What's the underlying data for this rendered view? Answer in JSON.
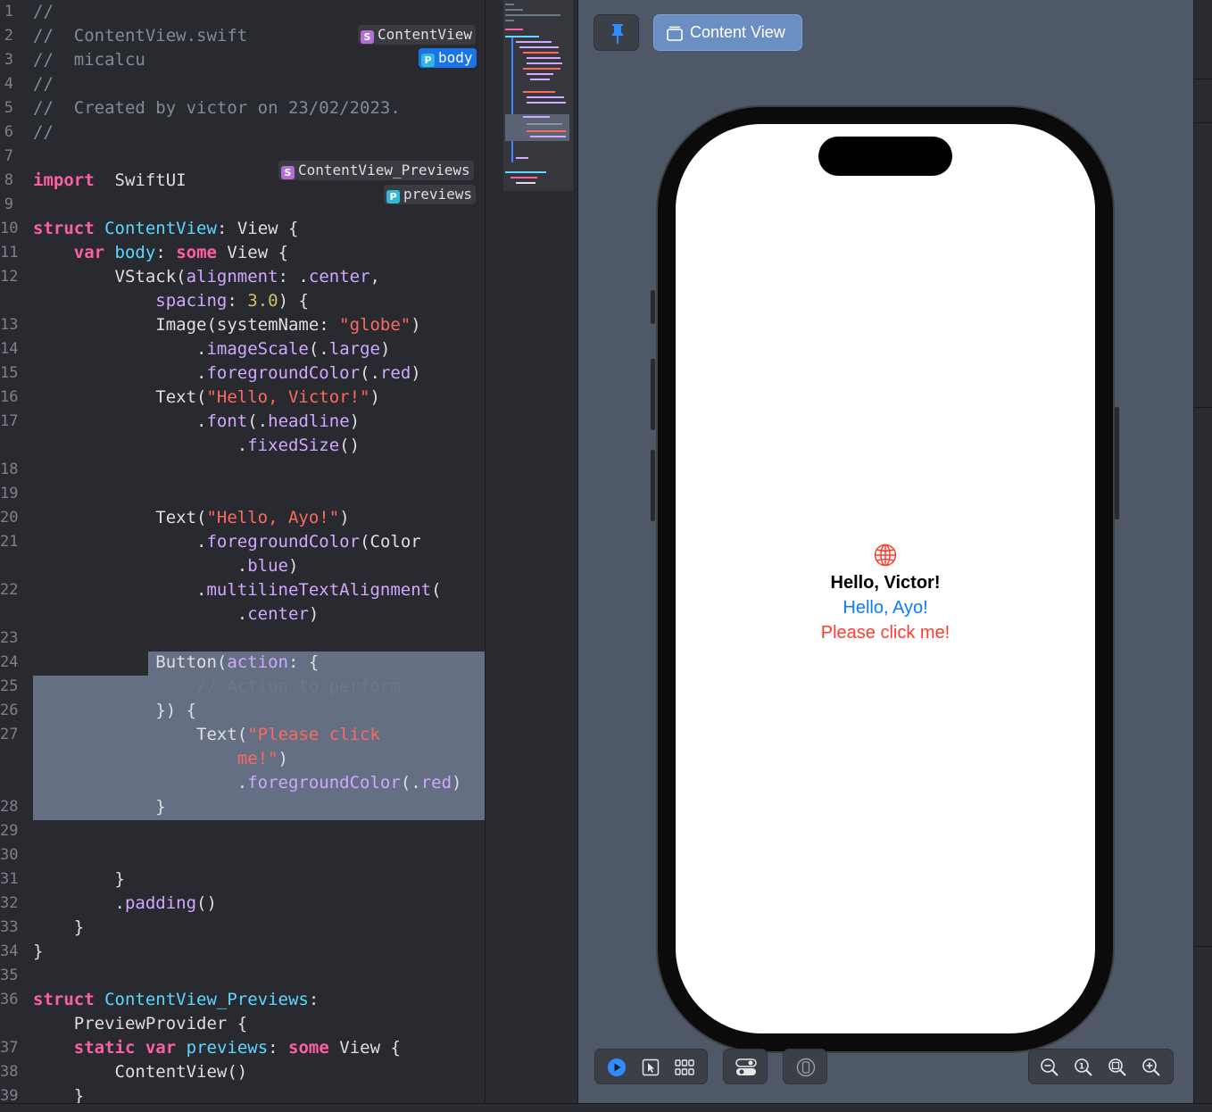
{
  "editor": {
    "lines": [
      {
        "n": "1",
        "t": [
          [
            "cm",
            "//"
          ]
        ]
      },
      {
        "n": "2",
        "t": [
          [
            "cm",
            "//  ContentView.swift"
          ]
        ]
      },
      {
        "n": "3",
        "t": [
          [
            "cm",
            "//  micalcu"
          ]
        ]
      },
      {
        "n": "4",
        "t": [
          [
            "cm",
            "//"
          ]
        ]
      },
      {
        "n": "5",
        "t": [
          [
            "cm",
            "//  Created by victor on 23/02/2023."
          ]
        ]
      },
      {
        "n": "6",
        "t": [
          [
            "cm",
            "//"
          ]
        ]
      },
      {
        "n": "7",
        "t": []
      },
      {
        "n": "8",
        "t": [
          [
            "kw",
            "import"
          ],
          [
            "",
            "  SwiftUI"
          ]
        ]
      },
      {
        "n": "9",
        "t": []
      },
      {
        "n": "10",
        "t": [
          [
            "kw",
            "struct"
          ],
          [
            "",
            " "
          ],
          [
            "ty",
            "ContentView"
          ],
          [
            "",
            ": View {"
          ]
        ]
      },
      {
        "n": "11",
        "t": [
          [
            "",
            "    "
          ],
          [
            "kw",
            "var"
          ],
          [
            "",
            " "
          ],
          [
            "ty",
            "body"
          ],
          [
            "",
            ": "
          ],
          [
            "kw",
            "some"
          ],
          [
            "",
            " View {"
          ]
        ]
      },
      {
        "n": "12",
        "t": [
          [
            "",
            "        VStack("
          ],
          [
            "pr",
            "alignment"
          ],
          [
            "",
            ": ."
          ],
          [
            "pr",
            "center"
          ],
          [
            "",
            ","
          ]
        ]
      },
      {
        "n": "",
        "t": [
          [
            "",
            "            "
          ],
          [
            "pr",
            "spacing"
          ],
          [
            "",
            ": "
          ],
          [
            "nm",
            "3.0"
          ],
          [
            "",
            ") {"
          ]
        ]
      },
      {
        "n": "13",
        "t": [
          [
            "",
            "            Image(systemName: "
          ],
          [
            "st",
            "\"globe\""
          ],
          [
            "",
            ")"
          ]
        ]
      },
      {
        "n": "14",
        "t": [
          [
            "",
            "                ."
          ],
          [
            "pr",
            "imageScale"
          ],
          [
            "",
            "(."
          ],
          [
            "pr",
            "large"
          ],
          [
            "",
            ")"
          ]
        ]
      },
      {
        "n": "15",
        "t": [
          [
            "",
            "                ."
          ],
          [
            "pr",
            "foregroundColor"
          ],
          [
            "",
            "(."
          ],
          [
            "pr",
            "red"
          ],
          [
            "",
            ")"
          ]
        ]
      },
      {
        "n": "16",
        "t": [
          [
            "",
            "            Text("
          ],
          [
            "st",
            "\"Hello, Victor!\""
          ],
          [
            "",
            ")"
          ]
        ]
      },
      {
        "n": "17",
        "t": [
          [
            "",
            "                ."
          ],
          [
            "pr",
            "font"
          ],
          [
            "",
            "(."
          ],
          [
            "pr",
            "headline"
          ],
          [
            "",
            ")"
          ]
        ]
      },
      {
        "n": "",
        "t": [
          [
            "",
            "                    ."
          ],
          [
            "pr",
            "fixedSize"
          ],
          [
            "",
            "()"
          ]
        ]
      },
      {
        "n": "18",
        "t": []
      },
      {
        "n": "19",
        "t": []
      },
      {
        "n": "20",
        "t": [
          [
            "",
            "            Text("
          ],
          [
            "st",
            "\"Hello, Ayo!\""
          ],
          [
            "",
            ")"
          ]
        ]
      },
      {
        "n": "21",
        "t": [
          [
            "",
            "                ."
          ],
          [
            "pr",
            "foregroundColor"
          ],
          [
            "",
            "(Color"
          ]
        ]
      },
      {
        "n": "",
        "t": [
          [
            "",
            "                    ."
          ],
          [
            "pr",
            "blue"
          ],
          [
            "",
            ")"
          ]
        ]
      },
      {
        "n": "22",
        "t": [
          [
            "",
            "                ."
          ],
          [
            "pr",
            "multilineTextAlignment"
          ],
          [
            "",
            "("
          ]
        ]
      },
      {
        "n": "",
        "t": [
          [
            "",
            "                    ."
          ],
          [
            "pr",
            "center"
          ],
          [
            "",
            ")"
          ]
        ]
      },
      {
        "n": "23",
        "t": []
      },
      {
        "n": "24",
        "t": [
          [
            "",
            "            Button("
          ],
          [
            "pr",
            "action"
          ],
          [
            "",
            ": {"
          ]
        ]
      },
      {
        "n": "25",
        "t": [
          [
            "",
            "                "
          ],
          [
            "cmd",
            "// Action to perform"
          ]
        ]
      },
      {
        "n": "26",
        "t": [
          [
            "",
            "            }) {"
          ]
        ]
      },
      {
        "n": "27",
        "t": [
          [
            "",
            "                Text("
          ],
          [
            "st",
            "\"Please click"
          ]
        ]
      },
      {
        "n": "",
        "t": [
          [
            "",
            "                    "
          ],
          [
            "st",
            "me!\""
          ],
          [
            "",
            ")"
          ]
        ]
      },
      {
        "n": "",
        "t": [
          [
            "",
            "                    ."
          ],
          [
            "pr",
            "foregroundColor"
          ],
          [
            "",
            "(."
          ],
          [
            "pr",
            "red"
          ],
          [
            "",
            ")"
          ]
        ]
      },
      {
        "n": "28",
        "t": [
          [
            "",
            "            }"
          ]
        ]
      },
      {
        "n": "29",
        "t": []
      },
      {
        "n": "30",
        "t": []
      },
      {
        "n": "31",
        "t": [
          [
            "",
            "        }"
          ]
        ]
      },
      {
        "n": "32",
        "t": [
          [
            "",
            "        ."
          ],
          [
            "pr",
            "padding"
          ],
          [
            "",
            "()"
          ]
        ]
      },
      {
        "n": "33",
        "t": [
          [
            "",
            "    }"
          ]
        ]
      },
      {
        "n": "34",
        "t": [
          [
            "",
            "}"
          ]
        ]
      },
      {
        "n": "35",
        "t": []
      },
      {
        "n": "36",
        "t": [
          [
            "kw",
            "struct"
          ],
          [
            "",
            " "
          ],
          [
            "ty",
            "ContentView_Previews"
          ],
          [
            "",
            ":"
          ]
        ]
      },
      {
        "n": "",
        "t": [
          [
            "",
            "    PreviewProvider {"
          ]
        ]
      },
      {
        "n": "37",
        "t": [
          [
            "",
            "    "
          ],
          [
            "kw",
            "static"
          ],
          [
            "",
            " "
          ],
          [
            "kw",
            "var"
          ],
          [
            "",
            " "
          ],
          [
            "ty",
            "previews"
          ],
          [
            "",
            ": "
          ],
          [
            "kw",
            "some"
          ],
          [
            "",
            " View {"
          ]
        ]
      },
      {
        "n": "38",
        "t": [
          [
            "",
            "        ContentView()"
          ]
        ]
      },
      {
        "n": "39",
        "t": [
          [
            "",
            "    }"
          ]
        ]
      }
    ],
    "badges": {
      "content_view": "ContentView",
      "body": "body",
      "content_view_previews": "ContentView_Previews",
      "previews": "previews",
      "struct_letter": "S",
      "property_letter": "P"
    }
  },
  "canvas": {
    "preview_pill_label": "Content View",
    "screen": {
      "title": "Hello, Victor!",
      "subtitle": "Hello, Ayo!",
      "button": "Please click me!"
    },
    "icons": {
      "pin": "pin-icon",
      "preview_frame": "preview-frame-icon",
      "live": "live-play-icon",
      "selectable": "selectable-cursor-icon",
      "variants": "variants-grid-icon",
      "device_settings": "device-settings-icon",
      "device": "device-icon",
      "zoom_out": "zoom-out-icon",
      "zoom_100": "zoom-100-icon",
      "zoom_fit": "zoom-fit-icon",
      "zoom_in": "zoom-in-icon",
      "globe": "globe-icon"
    },
    "zoom_100_label": "1",
    "colors": {
      "red": "#ff3b30",
      "blue": "#0a7aff",
      "accent": "#1b73e8"
    }
  }
}
